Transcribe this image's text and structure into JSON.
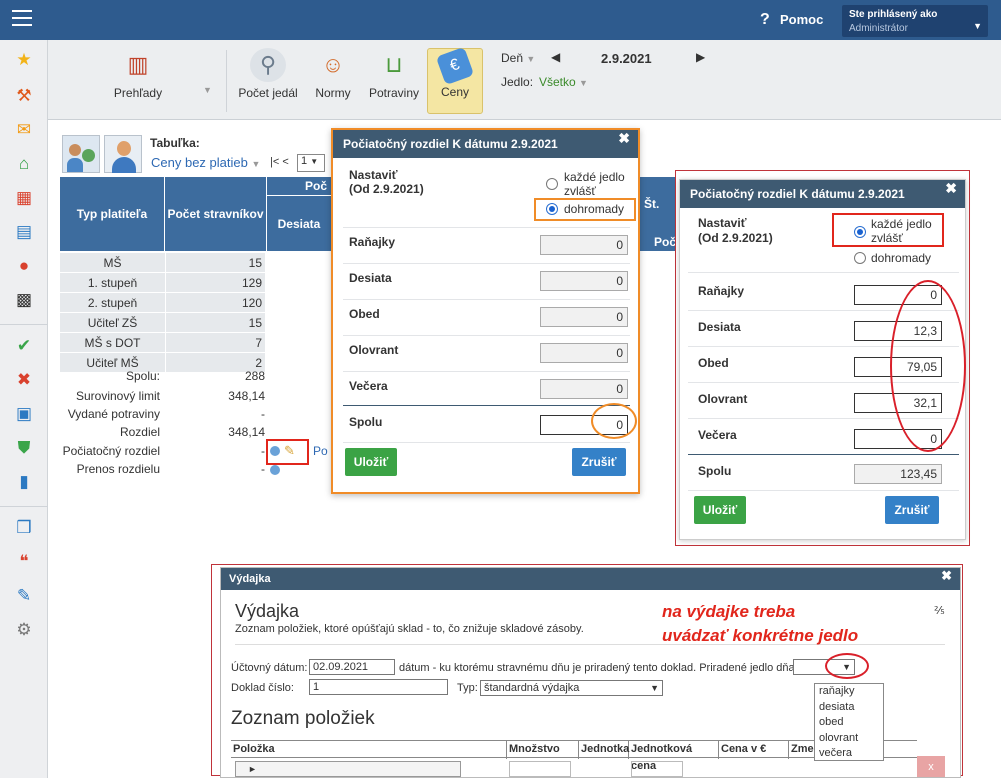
{
  "header": {
    "help_label": "Pomoc",
    "user_line1": "Ste prihlásený ako",
    "user_line2": "Administrátor"
  },
  "ribbon": {
    "prehlady": "Prehľady",
    "pocet_jedal": "Počet jedál",
    "normy": "Normy",
    "potraviny": "Potraviny",
    "ceny": "Ceny",
    "den_label": "Deň",
    "date": "2.9.2021",
    "jedlo_label": "Jedlo:",
    "jedlo_value": "Všetko"
  },
  "tabulka": {
    "label": "Tabuľka:",
    "selected": "Ceny bez platieb",
    "pager_prev": "|< <",
    "pager_page": "1"
  },
  "table": {
    "col_typ": "Typ platiteľa",
    "col_pocet": "Počet stravníkov",
    "col_poc": "Poč",
    "col_desiata": "Desiata",
    "rows": [
      {
        "typ": "MŠ",
        "pocet": "15"
      },
      {
        "typ": "1. stupeň",
        "pocet": "129"
      },
      {
        "typ": "2. stupeň",
        "pocet": "120"
      },
      {
        "typ": "Učiteľ ZŠ",
        "pocet": "15"
      },
      {
        "typ": "MŠ s DOT",
        "pocet": "7"
      },
      {
        "typ": "Učiteľ MŠ",
        "pocet": "2"
      }
    ],
    "summary": [
      {
        "label": "Spolu:",
        "value": "288"
      },
      {
        "label": "Surovinový limit",
        "value": "348,14"
      },
      {
        "label": "Vydané potraviny",
        "value": "-"
      },
      {
        "label": "Rozdiel",
        "value": "348,14"
      },
      {
        "label": "Počiatočný rozdiel",
        "value": "-"
      },
      {
        "label": "Prenos rozdielu",
        "value": "-"
      }
    ],
    "st_label": "Št.",
    "poc2": "Poč",
    "pom_link": "Po"
  },
  "dialog1": {
    "title": "Počiatočný rozdiel K dátumu 2.9.2021",
    "set_label": "Nastaviť",
    "set_sub": "(Od 2.9.2021)",
    "opt1": "každé jedlo zvlášť",
    "opt2": "dohromady",
    "rows": [
      {
        "label": "Raňajky",
        "value": "0"
      },
      {
        "label": "Desiata",
        "value": "0"
      },
      {
        "label": "Obed",
        "value": "0"
      },
      {
        "label": "Olovrant",
        "value": "0"
      },
      {
        "label": "Večera",
        "value": "0"
      }
    ],
    "spolu_label": "Spolu",
    "spolu_value": "0",
    "save": "Uložiť",
    "cancel": "Zrušiť"
  },
  "dialog2": {
    "title": "Počiatočný rozdiel K dátumu 2.9.2021",
    "set_label": "Nastaviť",
    "set_sub": "(Od 2.9.2021)",
    "opt1": "každé jedlo zvlášť",
    "opt2": "dohromady",
    "rows": [
      {
        "label": "Raňajky",
        "value": "0"
      },
      {
        "label": "Desiata",
        "value": "12,3"
      },
      {
        "label": "Obed",
        "value": "79,05"
      },
      {
        "label": "Olovrant",
        "value": "32,1"
      },
      {
        "label": "Večera",
        "value": "0"
      }
    ],
    "spolu_label": "Spolu",
    "spolu_value": "123,45",
    "save": "Uložiť",
    "cancel": "Zrušiť"
  },
  "vydajka": {
    "head": "Výdajka",
    "title": "Výdajka",
    "desc": "Zoznam položiek, ktoré opúšťajú sklad - to, čo znižuje skladové zásoby.",
    "page": "⅖",
    "datum_label": "Účtovný dátum:",
    "datum_value": "02.09.2021",
    "datum_help": "dátum - ku ktorému stravnému dňu je priradený tento doklad. Priradené jedlo dňa:",
    "doklad_label": "Doklad číslo:",
    "doklad_value": "1",
    "typ_label": "Typ:",
    "typ_value": "štandardná výdajka",
    "zoznam_title": "Zoznam položiek",
    "cols": [
      "Položka",
      "Množstvo",
      "Jednotka",
      "Jednotková cena",
      "Cena v €",
      "Zme"
    ],
    "dropdown": [
      "raňajky",
      "desiata",
      "obed",
      "olovrant",
      "večera"
    ],
    "del_btn": "x"
  },
  "annotation": {
    "line1": "na výdajke treba",
    "line2": "uvádzať konkrétne jedlo"
  }
}
